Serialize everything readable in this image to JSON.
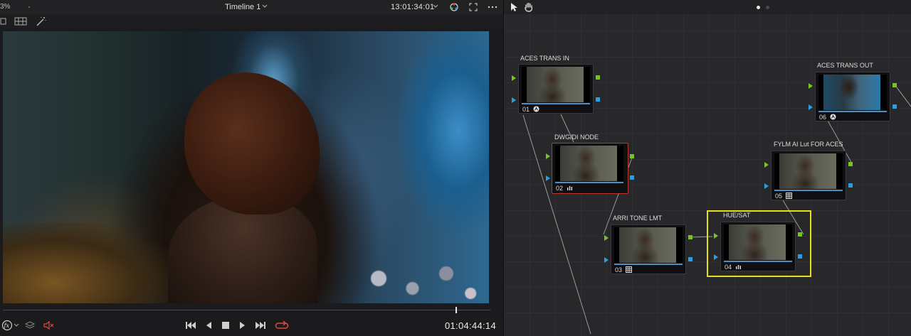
{
  "viewer": {
    "zoom": "3%",
    "timeline_name": "Timeline 1",
    "source_timecode": "13:01:34:01",
    "record_timecode": "01:04:44:14"
  },
  "nodes": [
    {
      "id": "01",
      "label": "ACES TRANS IN",
      "icon": "aces-icon"
    },
    {
      "id": "02",
      "label": "DWG/DI NODE",
      "icon": "curves-icon"
    },
    {
      "id": "03",
      "label": "ARRI TONE LMT",
      "icon": "lut-grid-icon"
    },
    {
      "id": "04",
      "label": "HUE/SAT",
      "icon": "curves-icon"
    },
    {
      "id": "05",
      "label": "FYLM AI Lut FOR ACES",
      "icon": "lut-grid-icon"
    },
    {
      "id": "06",
      "label": "ACES TRANS OUT",
      "icon": "aces-icon"
    }
  ],
  "colors": {
    "accent_blue": "#4e8fc6",
    "port_green": "#7ac41f",
    "port_blue": "#2a9fe0",
    "selected_node": "#e7de1d",
    "previous_selected": "#b23b30",
    "mute_red": "#e04a3c",
    "loop_red": "#e04a3c"
  }
}
